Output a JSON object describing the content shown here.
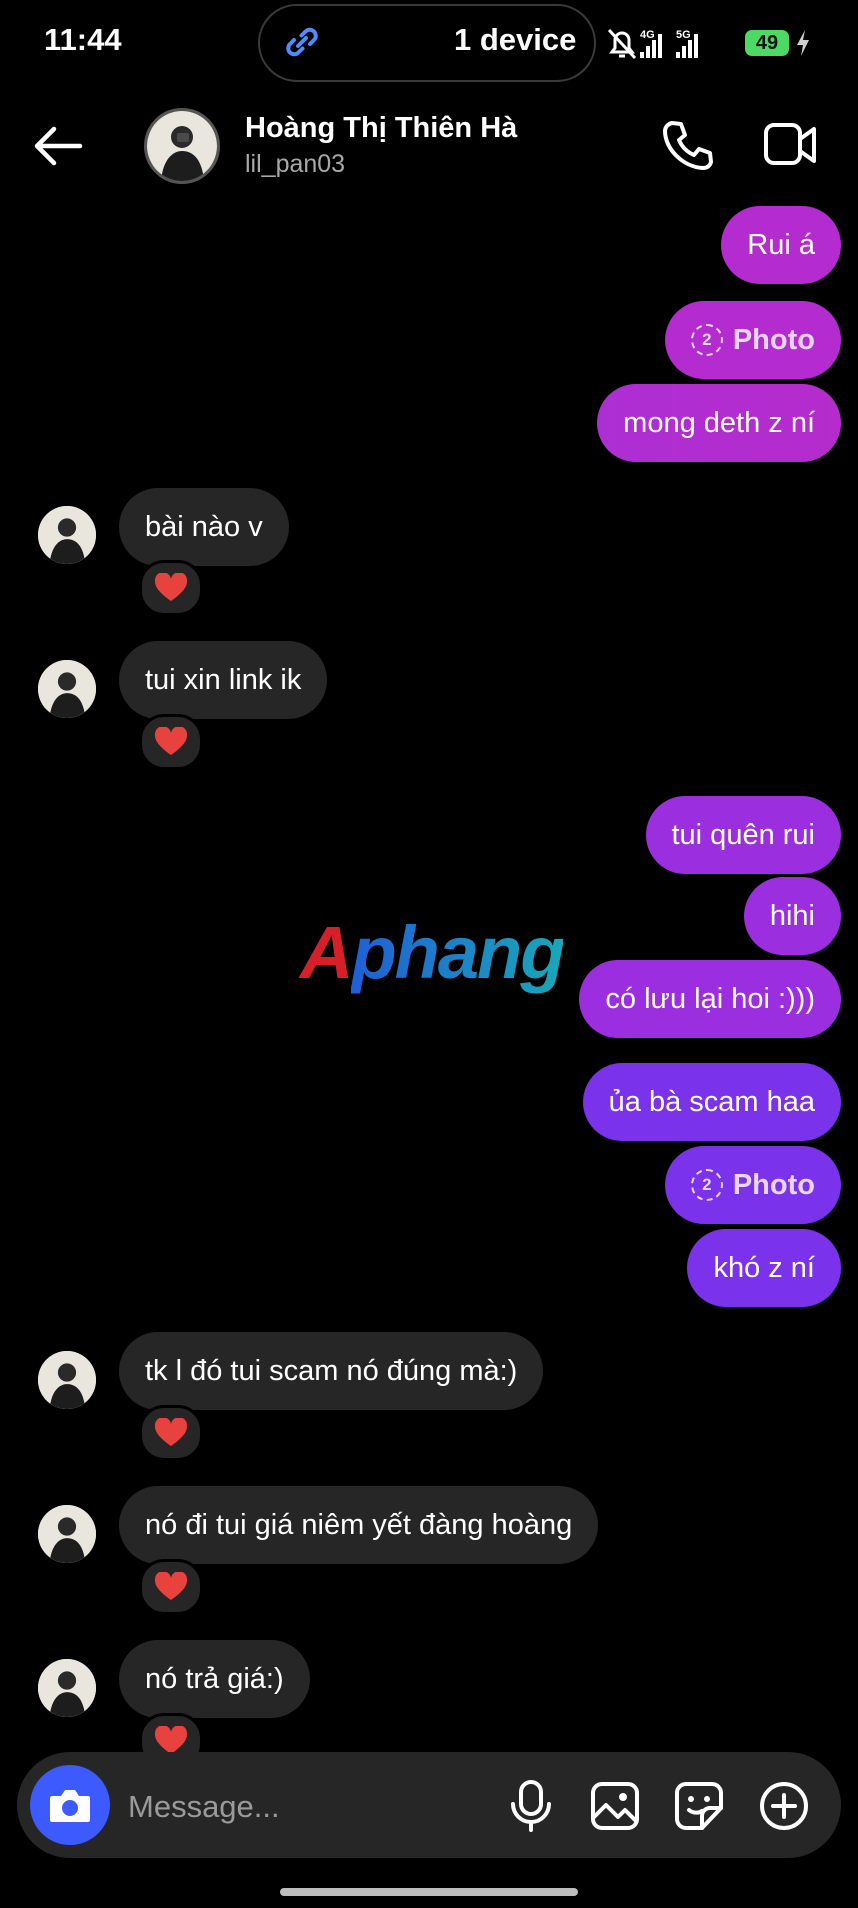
{
  "status_bar": {
    "time": "11:44",
    "island_text": "1 device",
    "network_a": "4G",
    "network_b": "5G",
    "battery": "49"
  },
  "header": {
    "name": "Hoàng Thị Thiên Hà",
    "username": "lil_pan03"
  },
  "messages": [
    {
      "dir": "out",
      "text": "Rui á"
    },
    {
      "dir": "out",
      "type": "photo",
      "badge": "2",
      "text": "Photo"
    },
    {
      "dir": "out",
      "text": "mong deth z ní"
    },
    {
      "dir": "in",
      "text": "bài nào v",
      "reaction": "❤️"
    },
    {
      "dir": "in",
      "text": "tui xin link ik",
      "reaction": "❤️"
    },
    {
      "dir": "out",
      "text": "tui quên rui"
    },
    {
      "dir": "out",
      "text": "hihi"
    },
    {
      "dir": "out",
      "text": "có lưu lại hoi :)))"
    },
    {
      "dir": "out",
      "text": "ủa bà scam haa"
    },
    {
      "dir": "out",
      "type": "photo",
      "badge": "2",
      "text": "Photo"
    },
    {
      "dir": "out",
      "text": "khó z ní"
    },
    {
      "dir": "in",
      "text": "tk l đó tui scam nó đúng mà:)",
      "reaction": "❤️"
    },
    {
      "dir": "in",
      "text": "nó đi tui giá niêm yết đàng hoàng",
      "reaction": "❤️"
    },
    {
      "dir": "in",
      "text": "nó trả giá:)",
      "reaction": "❤️"
    }
  ],
  "watermark": {
    "letter": "A",
    "rest": "phang"
  },
  "composer": {
    "placeholder": "Message..."
  },
  "colors": {
    "background": "#000000",
    "incoming_bubble": "#262626",
    "outgoing_top": "#b42ccf",
    "outgoing_mid": "#9b2fe0",
    "outgoing_bottom": "#7a33ea",
    "camera_button": "#3d5afe"
  },
  "icons": [
    "back-arrow-icon",
    "phone-icon",
    "video-camera-icon",
    "camera-icon",
    "microphone-icon",
    "gallery-icon",
    "sticker-icon",
    "plus-icon",
    "link-icon",
    "mute-bell-icon",
    "signal-icon",
    "charging-icon"
  ]
}
